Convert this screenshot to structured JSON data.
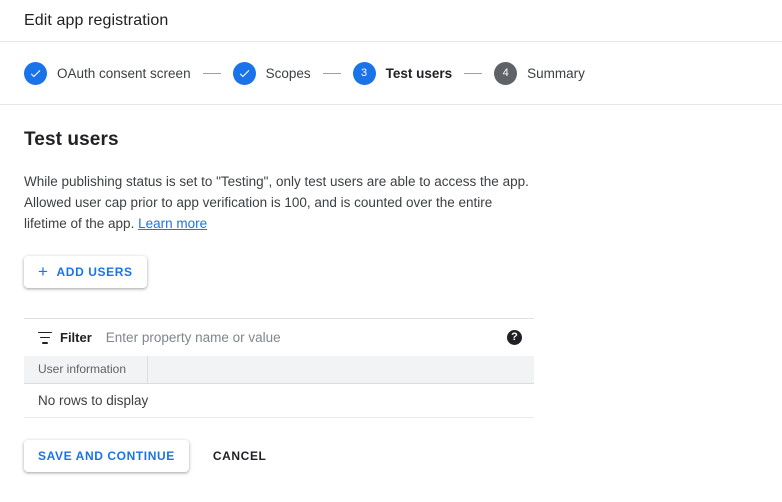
{
  "header": {
    "title": "Edit app registration"
  },
  "stepper": {
    "steps": [
      {
        "badge": "check-icon",
        "label": "OAuth consent screen",
        "state": "done"
      },
      {
        "badge": "check-icon",
        "label": "Scopes",
        "state": "done"
      },
      {
        "badge": "3",
        "label": "Test users",
        "state": "current"
      },
      {
        "badge": "4",
        "label": "Summary",
        "state": "upcoming"
      }
    ]
  },
  "main": {
    "section_title": "Test users",
    "description_part1": "While publishing status is set to \"Testing\", only test users are able to access the app. Allowed user cap prior to app verification is 100, and is counted over the entire lifetime of the app. ",
    "learn_more_label": "Learn more",
    "add_users_label": "ADD USERS",
    "add_users_icon": "plus-icon"
  },
  "table": {
    "filter": {
      "icon": "filter-icon",
      "label": "Filter",
      "value": "",
      "placeholder": "Enter property name or value",
      "help_icon": "help-circle-icon",
      "help_glyph": "?"
    },
    "columns": [
      "User information",
      ""
    ],
    "empty_message": "No rows to display",
    "rows": []
  },
  "footer": {
    "save_label": "SAVE AND CONTINUE",
    "cancel_label": "CANCEL"
  },
  "colors": {
    "accent": "#1a73e8",
    "upcoming_step": "#5f6368",
    "text_primary": "#202124",
    "text_secondary": "#5f6368",
    "header_row_bg": "#f1f3f4",
    "divider": "#e0e0e0"
  }
}
